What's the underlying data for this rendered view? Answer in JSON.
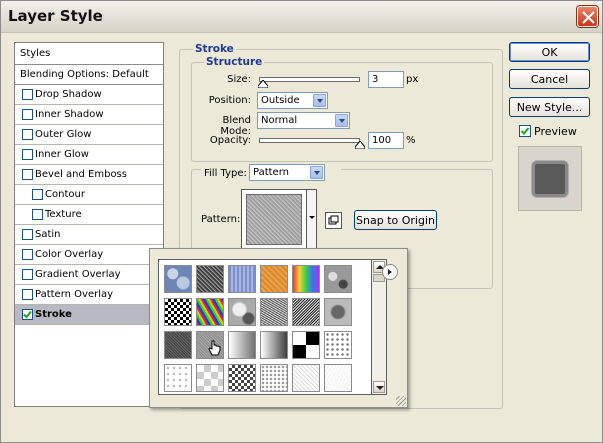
{
  "window": {
    "title": "Layer Style"
  },
  "styles_panel": {
    "header": "Styles",
    "items": [
      {
        "label": "Blending Options: Default",
        "checkbox": false,
        "checked": false,
        "indent": 0,
        "selected": false
      },
      {
        "label": "Drop Shadow",
        "checkbox": true,
        "checked": false,
        "indent": 0,
        "selected": false
      },
      {
        "label": "Inner Shadow",
        "checkbox": true,
        "checked": false,
        "indent": 0,
        "selected": false
      },
      {
        "label": "Outer Glow",
        "checkbox": true,
        "checked": false,
        "indent": 0,
        "selected": false
      },
      {
        "label": "Inner Glow",
        "checkbox": true,
        "checked": false,
        "indent": 0,
        "selected": false
      },
      {
        "label": "Bevel and Emboss",
        "checkbox": true,
        "checked": false,
        "indent": 0,
        "selected": false
      },
      {
        "label": "Contour",
        "checkbox": true,
        "checked": false,
        "indent": 1,
        "selected": false
      },
      {
        "label": "Texture",
        "checkbox": true,
        "checked": false,
        "indent": 1,
        "selected": false
      },
      {
        "label": "Satin",
        "checkbox": true,
        "checked": false,
        "indent": 0,
        "selected": false
      },
      {
        "label": "Color Overlay",
        "checkbox": true,
        "checked": false,
        "indent": 0,
        "selected": false
      },
      {
        "label": "Gradient Overlay",
        "checkbox": true,
        "checked": false,
        "indent": 0,
        "selected": false
      },
      {
        "label": "Pattern Overlay",
        "checkbox": true,
        "checked": false,
        "indent": 0,
        "selected": false
      },
      {
        "label": "Stroke",
        "checkbox": true,
        "checked": true,
        "indent": 0,
        "selected": true
      }
    ]
  },
  "stroke": {
    "section_title": "Stroke",
    "structure_title": "Structure",
    "size_label": "Size:",
    "size_value": "3",
    "size_unit": "px",
    "size_slider_fraction": 0.03,
    "position_label": "Position:",
    "position_value": "Outside",
    "blend_mode_label": "Blend Mode:",
    "blend_mode_value": "Normal",
    "opacity_label": "Opacity:",
    "opacity_value": "100",
    "opacity_unit": "%",
    "opacity_slider_fraction": 1.0,
    "fill_type_label": "Fill Type:",
    "fill_type_value": "Pattern",
    "pattern_label": "Pattern:",
    "snap_button": "Snap to Origin"
  },
  "buttons": {
    "ok": "OK",
    "cancel": "Cancel",
    "new_style": "New Style...",
    "preview_label": "Preview",
    "preview_checked": true
  },
  "pattern_picker": {
    "swatches": [
      "bubbles",
      "noise-dark",
      "blue-fabric",
      "orange-burlap",
      "rainbow",
      "gray-marble",
      "checker-small",
      "multicolor-confetti",
      "gray-clouds",
      "gray-noise",
      "woven-strip",
      "gray-stone",
      "dark-granite",
      "gray-gradient-selected",
      "gradient-light",
      "gradient-dark",
      "black-white-checker",
      "dot-grid",
      "light-dots",
      "light-checker",
      "small-checker",
      "dot-pattern",
      "light-mesh",
      "white-noise"
    ],
    "hover_index": 13
  }
}
